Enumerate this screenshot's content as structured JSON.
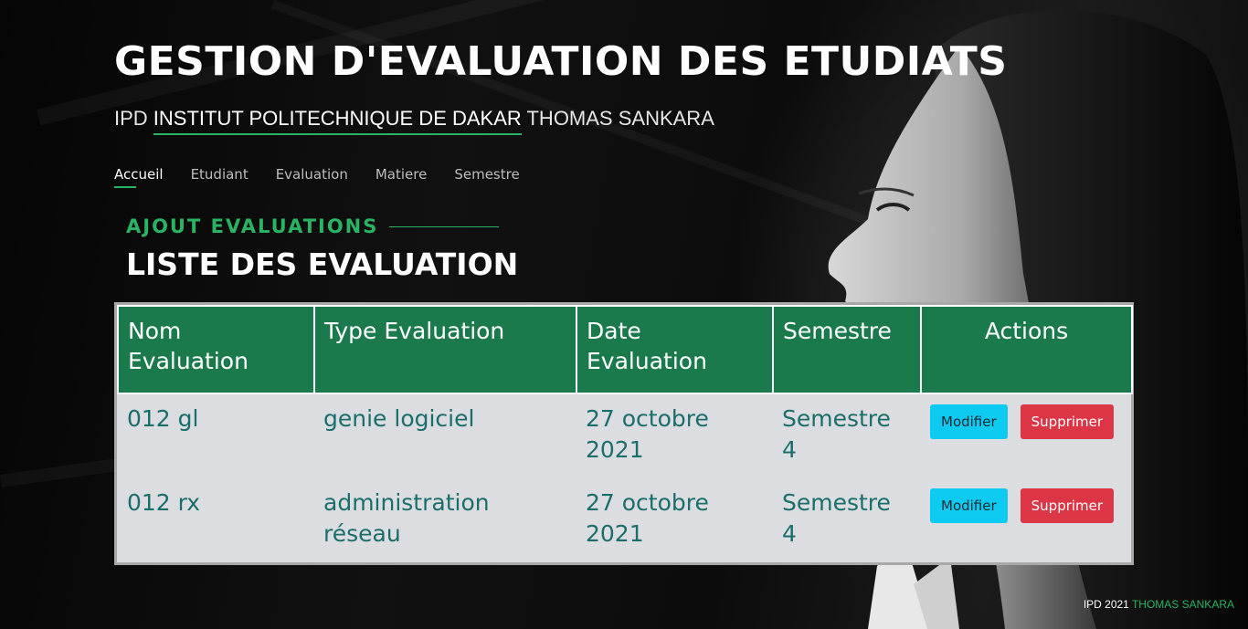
{
  "header": {
    "title": "GESTION D'EVALUATION DES ETUDIATS",
    "subtitle_prefix": "IPD ",
    "subtitle_underlined": "INSTITUT POLITECHNIQUE DE DAKAR",
    "subtitle_suffix": " THOMAS SANKARA"
  },
  "nav": {
    "items": [
      {
        "label": "Accueil"
      },
      {
        "label": "Etudiant"
      },
      {
        "label": "Evaluation"
      },
      {
        "label": "Matiere"
      },
      {
        "label": "Semestre"
      }
    ],
    "active": "Accueil"
  },
  "section": {
    "label": "AJOUT EVALUATIONS",
    "title": "LISTE DES EVALUATION"
  },
  "table": {
    "headers": [
      "Nom Evaluation",
      "Type Evaluation",
      "Date Evaluation",
      "Semestre",
      "Actions"
    ],
    "rows": [
      {
        "nom": "012 gl",
        "type": "genie logiciel",
        "date": "27 octobre 2021",
        "semestre": "Semestre 4",
        "modify_label": "Modifier",
        "delete_label": "Supprimer"
      },
      {
        "nom": "012 rx",
        "type": "administration réseau",
        "date": "27 octobre 2021",
        "semestre": "Semestre 4",
        "modify_label": "Modifier",
        "delete_label": "Supprimer"
      }
    ]
  },
  "footer": {
    "prefix": "IPD 2021 ",
    "highlight": "THOMAS SANKARA"
  },
  "colors": {
    "accent": "#28b463",
    "header_bg": "#1a7a4c",
    "cell_text": "#1a6e6a",
    "modify_button": "#0dcaf0",
    "delete_button": "#dc3545"
  }
}
